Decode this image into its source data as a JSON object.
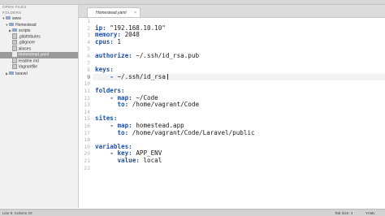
{
  "sidebar": {
    "open_files_header": "OPEN FILES",
    "folders_header": "FOLDERS",
    "items": [
      {
        "label": "www",
        "arrow": "▼",
        "type": "folder"
      },
      {
        "label": "Homestead",
        "arrow": "▼",
        "type": "folder"
      },
      {
        "label": "scripts",
        "arrow": "▶",
        "type": "folder"
      },
      {
        "label": ".gitattributes",
        "arrow": "",
        "type": "file"
      },
      {
        "label": ".gitignore",
        "arrow": "",
        "type": "file"
      },
      {
        "label": "aliases",
        "arrow": "",
        "type": "file"
      },
      {
        "label": "Homestead.yaml",
        "arrow": "",
        "type": "file"
      },
      {
        "label": "readme.md",
        "arrow": "",
        "type": "file"
      },
      {
        "label": "Vagrantfile",
        "arrow": "",
        "type": "file"
      },
      {
        "label": "laravel",
        "arrow": "▶",
        "type": "folder"
      }
    ]
  },
  "tab": {
    "label": "Homestead.yaml",
    "close": "×"
  },
  "editor": {
    "line_numbers": [
      "1",
      "2",
      "3",
      "4",
      "5",
      "6",
      "7",
      "8",
      "9",
      "10",
      "11",
      "12",
      "13",
      "14",
      "15",
      "16",
      "17",
      "18",
      "19",
      "20",
      "21",
      "22"
    ],
    "lines": {
      "l2_key": "ip:",
      "l2_val": " \"192.168.10.10\"",
      "l3_key": "memory:",
      "l3_val": " 2048",
      "l4_key": "cpus:",
      "l4_val": " 1",
      "l6_key": "authorize:",
      "l6_val": " ~/.ssh/id_rsa.pub",
      "l8_key": "keys:",
      "l9_dash": "- ",
      "l9_val": "~/.ssh/id_rsa",
      "l11_key": "folders:",
      "l12_dash": "- ",
      "l12_key": "map:",
      "l12_val": " ~/Code",
      "l13_key": "to:",
      "l13_val": " /home/vagrant/Code",
      "l15_key": "sites:",
      "l16_dash": "- ",
      "l16_key": "map:",
      "l16_val": " homestead.app",
      "l17_key": "to:",
      "l17_val": " /home/vagrant/Code/Laravel/public",
      "l19_key": "variables:",
      "l20_dash": "- ",
      "l20_key": "key:",
      "l20_val": " APP_ENV",
      "l21_key": "value:",
      "l21_val": " local"
    }
  },
  "statusbar": {
    "position": "Line 9, Column 20",
    "tab_size": "Tab Size: 4",
    "syntax": "YAML"
  }
}
